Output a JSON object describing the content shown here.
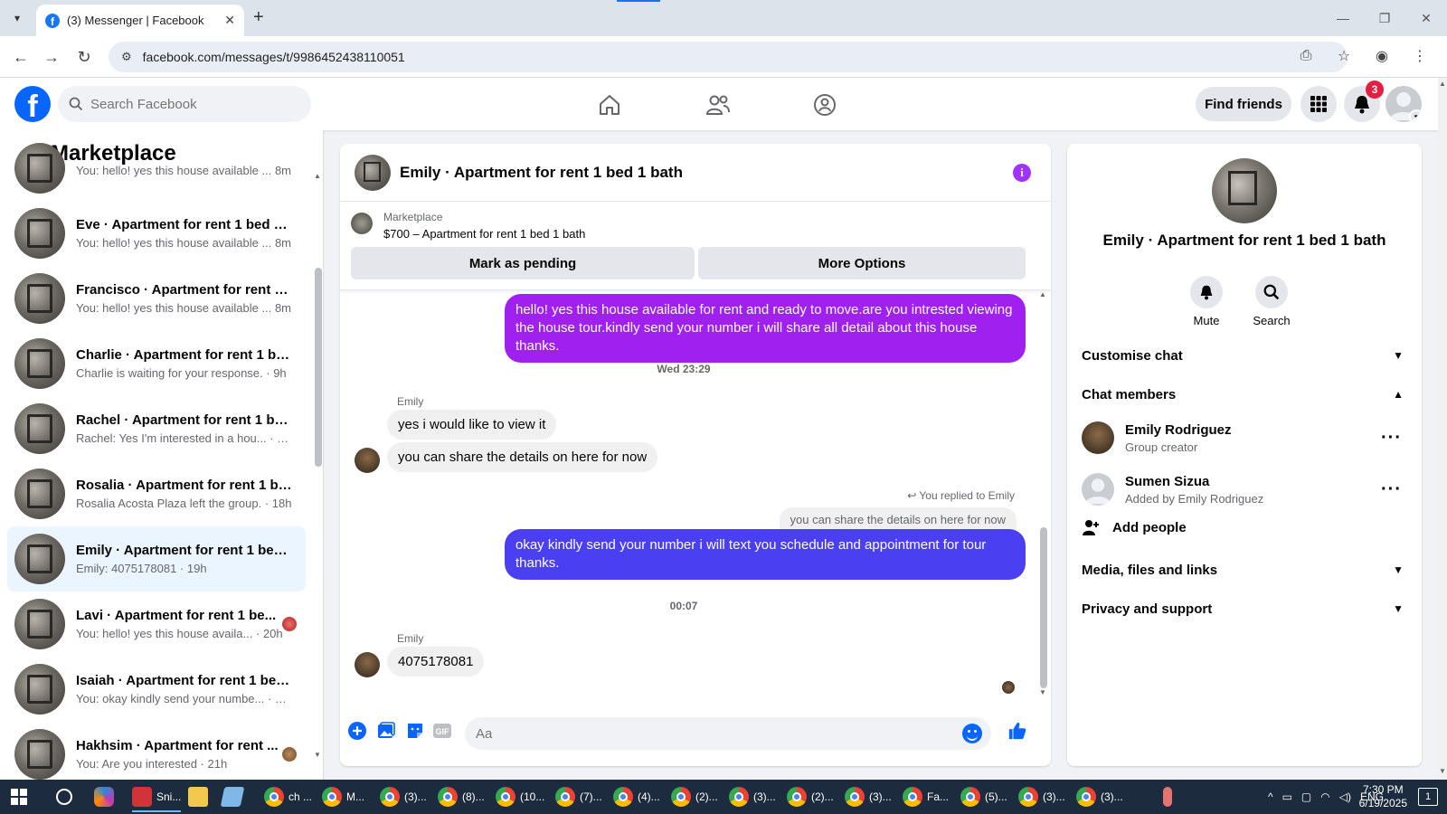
{
  "browser": {
    "tab_title": "(3) Messenger | Facebook",
    "url": "facebook.com/messages/t/9986452438110051"
  },
  "header": {
    "search_placeholder": "Search Facebook",
    "find_friends": "Find friends",
    "notification_count": "3"
  },
  "sidebar": {
    "title": "Marketplace",
    "conversations": [
      {
        "name": "",
        "preview": "You: hello! yes this house available ... 8m",
        "partial": true
      },
      {
        "name": "Eve · Apartment for rent 1 bed 1 ...",
        "preview": "You: hello! yes this house available ... 8m"
      },
      {
        "name": "Francisco · Apartment for rent 1 ...",
        "preview": "You: hello! yes this house available ... 8m"
      },
      {
        "name": "Charlie · Apartment for rent 1 be...",
        "preview": "Charlie is waiting for your response. · 9h"
      },
      {
        "name": "Rachel · Apartment for rent 1 be...",
        "preview": "Rachel: Yes I'm interested in a hou... · 12h"
      },
      {
        "name": "Rosalia · Apartment for rent 1 be...",
        "preview": "Rosalia Acosta Plaza left the group. · 18h"
      },
      {
        "name": "Emily · Apartment for rent 1 bed...",
        "preview": "Emily: 4075178081 · 19h",
        "active": true
      },
      {
        "name": "Lavi · Apartment for rent 1 be...",
        "preview": "You: hello! yes this house availa... · 20h",
        "seen": "red"
      },
      {
        "name": "Isaiah · Apartment for rent 1 bed...",
        "preview": "You: okay kindly send your numbe... · 21h"
      },
      {
        "name": "Hakhsim · Apartment for rent ...",
        "preview": "You: Are you interested · 21h",
        "seen": "brown"
      }
    ]
  },
  "chat": {
    "title": "Emily · Apartment for rent 1 bed 1 bath",
    "listing": {
      "category": "Marketplace",
      "price_title": "$700 – Apartment for rent 1 bed 1 bath",
      "mark_pending": "Mark as pending",
      "more_options": "More Options"
    },
    "messages": {
      "out1": "hello! yes this house available for rent and ready to move.are you intrested viewing the house tour.kindly send your number i will share all detail about this house thanks.",
      "ts1": "Wed 23:29",
      "sender1": "Emily",
      "in1": "yes i would like to view it",
      "in2": "you can share the details on here for now",
      "replied": "You replied to Emily",
      "quote": "you can share the details on here for now",
      "out2": "okay kindly send your number i will text you schedule and appointment for tour thanks.",
      "ts2": "00:07",
      "sender2": "Emily",
      "in3": "4075178081"
    },
    "composer_placeholder": "Aa"
  },
  "details": {
    "name": "Emily · Apartment for rent 1 bed 1 bath",
    "mute": "Mute",
    "search": "Search",
    "customise": "Customise chat",
    "members_header": "Chat members",
    "members": [
      {
        "name": "Emily Rodriguez",
        "role": "Group creator"
      },
      {
        "name": "Sumen Sizua",
        "role": "Added by Emily Rodriguez"
      }
    ],
    "add_people": "Add people",
    "media": "Media, files and links",
    "privacy": "Privacy and support"
  },
  "taskbar": {
    "items": [
      "Sni...",
      "ch ...",
      "M...",
      "(3)...",
      "(8)...",
      "(10...",
      "(7)...",
      "(4)...",
      "(2)...",
      "(3)...",
      "(2)...",
      "(3)...",
      "Fa...",
      "(5)...",
      "(3)...",
      "(3)..."
    ],
    "lang": "ENG",
    "time": "7:30 PM",
    "date": "6/19/2025",
    "notif": "1"
  },
  "colors": {
    "fb_blue": "#0866ff",
    "bubble_purple": "#a020f0",
    "bubble_blue": "#4b3ff2"
  }
}
